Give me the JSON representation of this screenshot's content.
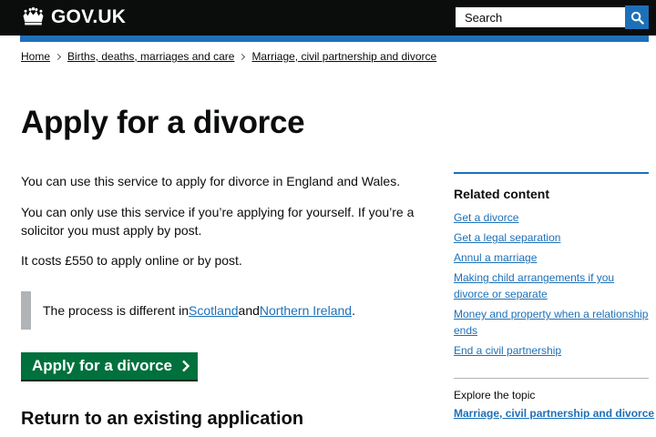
{
  "header": {
    "logo_text": "GOV.UK",
    "search_placeholder": "Search"
  },
  "breadcrumbs": [
    "Home",
    "Births, deaths, marriages and care",
    "Marriage, civil partnership and divorce"
  ],
  "main": {
    "title": "Apply for a divorce",
    "paragraphs": [
      "You can use this service to apply for divorce in England and Wales.",
      "You can only use this service if you’re applying for yourself. If you’re a solicitor you must apply by post.",
      "It costs £550 to apply online or by post."
    ],
    "inset": {
      "prefix": "The process is different in ",
      "link1": "Scotland",
      "middle": " and ",
      "link2": "Northern Ireland",
      "suffix": "."
    },
    "start_button_label": "Apply for a divorce",
    "subheading": "Return to an existing application"
  },
  "sidebar": {
    "title": "Related content",
    "links": [
      "Get a divorce",
      "Get a legal separation",
      "Annul a marriage",
      "Making child arrangements if you divorce or separate",
      "Money and property when a relationship ends",
      "End a civil partnership"
    ],
    "explore_label": "Explore the topic",
    "explore_link": "Marriage, civil partnership and divorce"
  },
  "colors": {
    "header_bg": "#0b0c0c",
    "brand_blue": "#1d70b8",
    "start_green": "#00703c",
    "inset_border": "#b1b4b6"
  },
  "icons": {
    "logo": "crown-icon",
    "search": "magnifier-icon",
    "start_arrow": "chevron-right-icon",
    "breadcrumb_separator": "chevron-right-icon"
  }
}
